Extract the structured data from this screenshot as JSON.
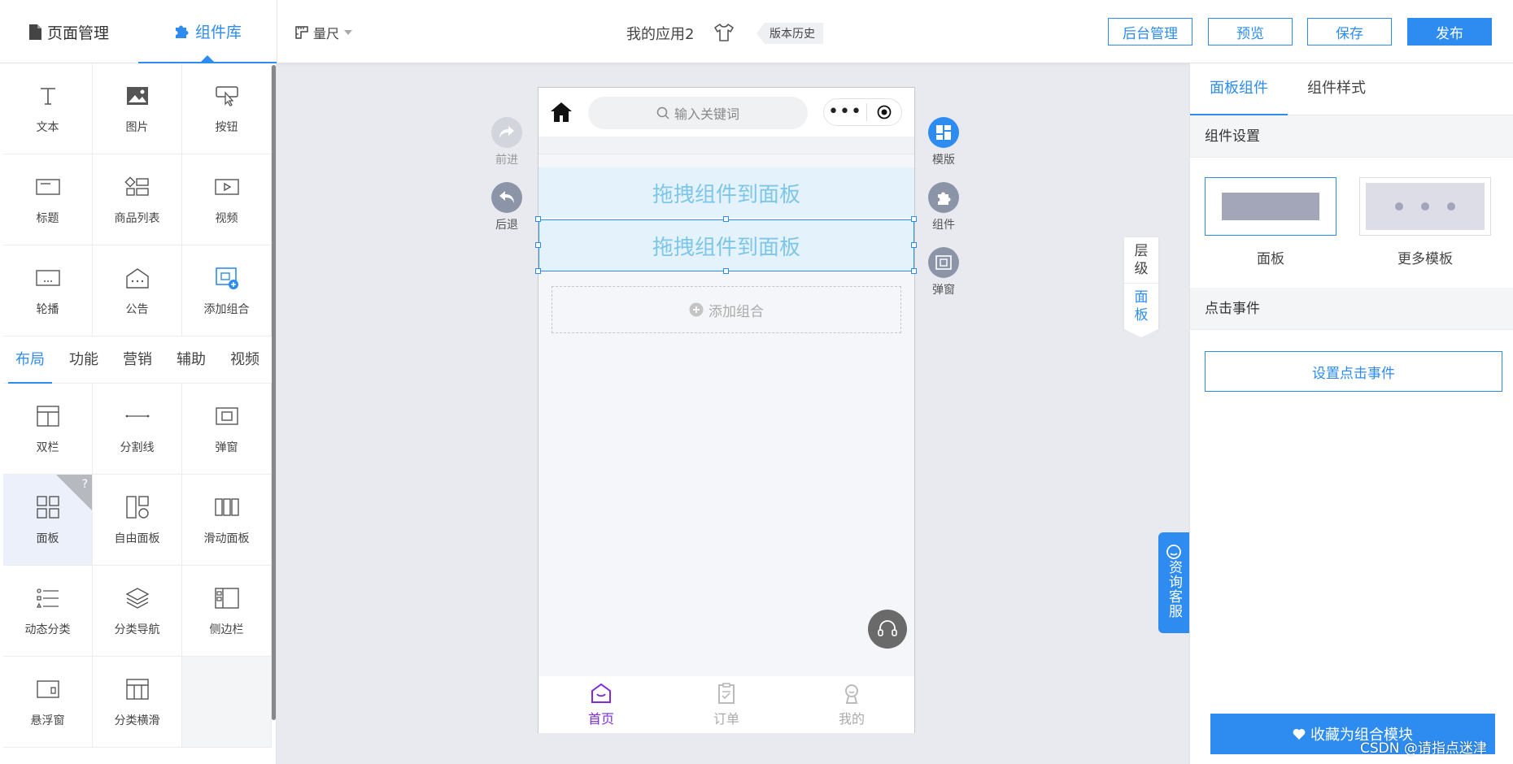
{
  "topbar": {
    "tab_pages": "页面管理",
    "tab_components": "组件库",
    "ruler": "量尺",
    "app_name": "我的应用2",
    "version_history": "版本历史",
    "btn_admin": "后台管理",
    "btn_preview": "预览",
    "btn_save": "保存",
    "btn_publish": "发布"
  },
  "components": {
    "basic": [
      "文本",
      "图片",
      "按钮",
      "标题",
      "商品列表",
      "视频",
      "轮播",
      "公告",
      "添加组合"
    ],
    "category_tabs": [
      "布局",
      "功能",
      "营销",
      "辅助",
      "视频"
    ],
    "active_category": "布局",
    "layout": [
      "双栏",
      "分割线",
      "弹窗",
      "面板",
      "自由面板",
      "滑动面板",
      "动态分类",
      "分类导航",
      "侧边栏",
      "悬浮窗",
      "分类横滑"
    ],
    "selected": "面板",
    "help_badge": "?"
  },
  "canvas": {
    "side_left": [
      "前进",
      "后退"
    ],
    "side_right": [
      "模版",
      "组件",
      "弹窗"
    ],
    "search_placeholder": "输入关键词",
    "capsule_dots": "•••",
    "drop_panel_1": "拖拽组件到面板",
    "drop_panel_2": "拖拽组件到面板",
    "add_group": "添加组合",
    "tabbar": [
      "首页",
      "订单",
      "我的"
    ],
    "active_tab": "首页",
    "vtabs": [
      "层级",
      "面板"
    ],
    "active_vtab": "面板",
    "consult": "资询客服"
  },
  "rightpanel": {
    "tab_panel_components": "面板组件",
    "tab_component_style": "组件样式",
    "section_settings": "组件设置",
    "template_panel": "面板",
    "template_more": "更多模板",
    "section_click": "点击事件",
    "btn_set_click": "设置点击事件",
    "btn_favorite": "收藏为组合模块"
  },
  "watermark": "CSDN @请指点迷津",
  "colors": {
    "accent": "#2e8cf0",
    "active_tab": "#7c2cdb",
    "drop_text": "#7ec6e9",
    "drop_bg": "#e4f3fb"
  }
}
